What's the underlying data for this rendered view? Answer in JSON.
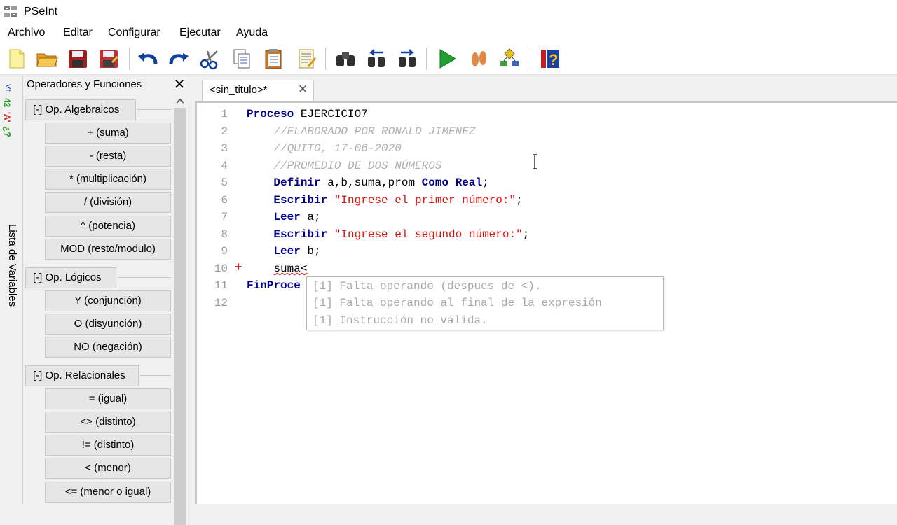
{
  "window": {
    "title": "PSeInt"
  },
  "menu": [
    "Archivo",
    "Editar",
    "Configurar",
    "Ejecutar",
    "Ayuda"
  ],
  "toolbar": {
    "buttons": [
      "new-file-icon",
      "open-folder-icon",
      "save-icon",
      "save-as-icon",
      "undo-icon",
      "redo-icon",
      "cut-icon",
      "copy-icon",
      "paste-icon",
      "edit-icon",
      "search-icon",
      "find-previous-icon",
      "find-next-icon",
      "run-icon",
      "step-by-step-icon",
      "flowchart-icon",
      "help-icon"
    ]
  },
  "side_strip": {
    "label": "Lista de Variables"
  },
  "panel": {
    "title": "Operadores y Funciones",
    "close_label": "✕",
    "categories": [
      {
        "label": "[-]  Op. Algebraicos",
        "items": [
          "+ (suma)",
          "- (resta)",
          "* (multiplicación)",
          "/ (división)",
          "^ (potencia)",
          "MOD (resto/modulo)"
        ]
      },
      {
        "label": "[-]  Op. Lógicos",
        "items": [
          "Y (conjunción)",
          "O (disyunción)",
          "NO (negación)"
        ]
      },
      {
        "label": "[-]  Op. Relacionales",
        "items": [
          "= (igual)",
          "<> (distinto)",
          "!= (distinto)",
          "< (menor)",
          "<= (menor o igual)"
        ]
      }
    ]
  },
  "tab": {
    "label": "<sin_titulo>*",
    "close_label": "✕"
  },
  "editor": {
    "line_numbers": [
      "1",
      "2",
      "3",
      "4",
      "5",
      "6",
      "7",
      "8",
      "9",
      "10",
      "11",
      "12"
    ],
    "error_marker": "+",
    "lines": {
      "l1_kw": "Proceso",
      "l1_id": " EJERCICIO7",
      "l2": "    //ELABORADO POR RONALD JIMENEZ",
      "l3": "    //QUITO, 17-06-2020",
      "l4": "    //PROMEDIO DE DOS NÚMEROS",
      "l5_kw": "Definir",
      "l5_id": " a,b,suma,prom ",
      "l5_kw2": "Como Real",
      "l5_end": ";",
      "l6_kw": "Escribir",
      "l6_st": "\"Ingrese el primer número:\"",
      "l6_end": ";",
      "l7_kw": "Leer",
      "l7_id": " a;",
      "l8_kw": "Escribir",
      "l8_st": "\"Ingrese el segundo número:\"",
      "l8_end": ";",
      "l9_kw": "Leer",
      "l9_id": " b;",
      "l10_id": "suma<",
      "l11_kw": "FinProce"
    }
  },
  "error_popup": [
    "[1] Falta operando (despues de <).",
    "[1] Falta operando al final de la expresión",
    "[1] Instrucción no válida."
  ]
}
